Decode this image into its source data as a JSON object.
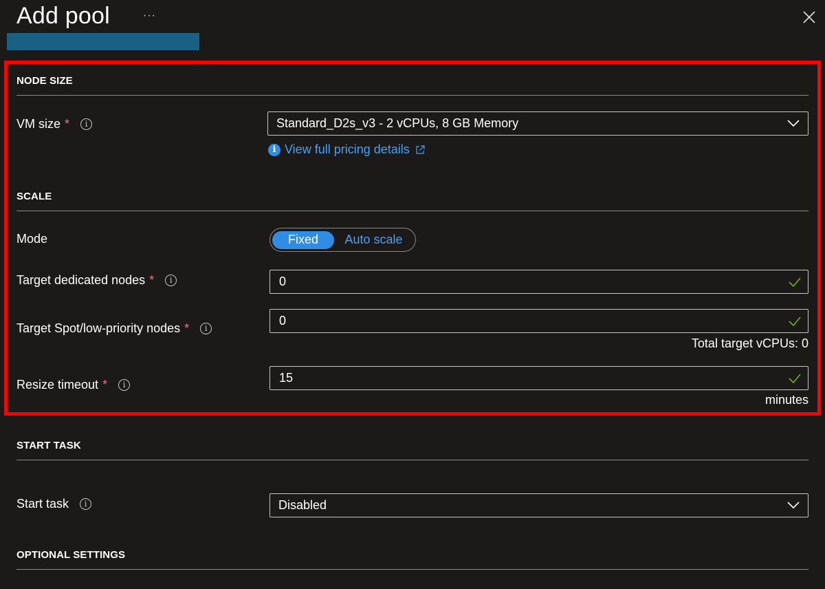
{
  "header": {
    "title": "Add pool",
    "more_label": "···"
  },
  "sections": {
    "node_size": "NODE SIZE",
    "scale": "SCALE",
    "start_task": "START TASK",
    "optional": "OPTIONAL SETTINGS"
  },
  "vm_size": {
    "label": "VM size",
    "required": "*",
    "value": "Standard_D2s_v3 - 2 vCPUs, 8 GB Memory",
    "pricing_link": "View full pricing details"
  },
  "mode": {
    "label": "Mode",
    "options": [
      "Fixed",
      "Auto scale"
    ],
    "selected": "Fixed"
  },
  "dedicated": {
    "label": "Target dedicated nodes",
    "required": "*",
    "value": "0"
  },
  "spot": {
    "label": "Target Spot/low-priority nodes",
    "required": "*",
    "value": "0",
    "hint": "Total target vCPUs: 0"
  },
  "resize": {
    "label": "Resize timeout",
    "required": "*",
    "value": "15",
    "unit": "minutes"
  },
  "start_task": {
    "label": "Start task",
    "value": "Disabled"
  },
  "colors": {
    "background": "#1b1a19",
    "accent": "#2f8de4",
    "link": "#4aa0f0",
    "required": "#f1707b",
    "valid": "#6bb700",
    "highlight": "#ff0000"
  },
  "icons": [
    "close-icon",
    "info-icon",
    "chevron-down-icon",
    "external-link-icon",
    "checkmark-icon"
  ]
}
